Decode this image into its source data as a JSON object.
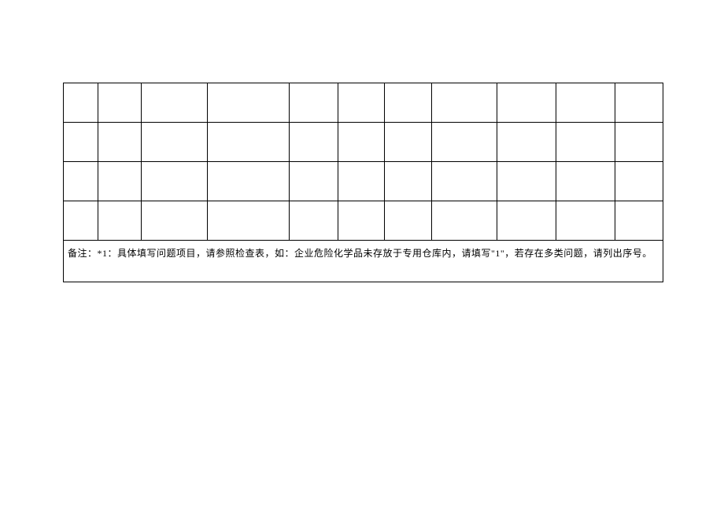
{
  "table": {
    "columns": 11,
    "rows": 4,
    "note": "备注：*1：具体填写问题项目，请参照检查表，如：企业危险化学品未存放于专用仓库内，请填写\"1\"，若存在多类问题，请列出序号。"
  }
}
